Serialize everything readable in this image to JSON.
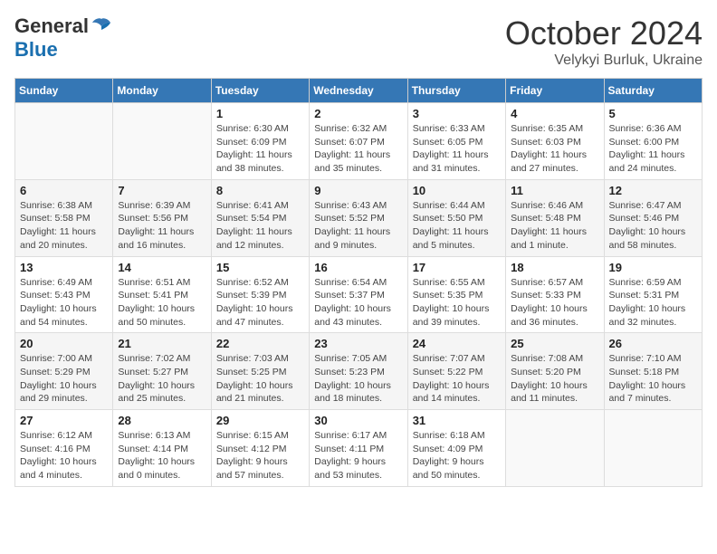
{
  "header": {
    "logo_general": "General",
    "logo_blue": "Blue",
    "month": "October 2024",
    "location": "Velykyi Burluk, Ukraine"
  },
  "weekdays": [
    "Sunday",
    "Monday",
    "Tuesday",
    "Wednesday",
    "Thursday",
    "Friday",
    "Saturday"
  ],
  "weeks": [
    [
      {
        "day": "",
        "sunrise": "",
        "sunset": "",
        "daylight": ""
      },
      {
        "day": "",
        "sunrise": "",
        "sunset": "",
        "daylight": ""
      },
      {
        "day": "1",
        "sunrise": "Sunrise: 6:30 AM",
        "sunset": "Sunset: 6:09 PM",
        "daylight": "Daylight: 11 hours and 38 minutes."
      },
      {
        "day": "2",
        "sunrise": "Sunrise: 6:32 AM",
        "sunset": "Sunset: 6:07 PM",
        "daylight": "Daylight: 11 hours and 35 minutes."
      },
      {
        "day": "3",
        "sunrise": "Sunrise: 6:33 AM",
        "sunset": "Sunset: 6:05 PM",
        "daylight": "Daylight: 11 hours and 31 minutes."
      },
      {
        "day": "4",
        "sunrise": "Sunrise: 6:35 AM",
        "sunset": "Sunset: 6:03 PM",
        "daylight": "Daylight: 11 hours and 27 minutes."
      },
      {
        "day": "5",
        "sunrise": "Sunrise: 6:36 AM",
        "sunset": "Sunset: 6:00 PM",
        "daylight": "Daylight: 11 hours and 24 minutes."
      }
    ],
    [
      {
        "day": "6",
        "sunrise": "Sunrise: 6:38 AM",
        "sunset": "Sunset: 5:58 PM",
        "daylight": "Daylight: 11 hours and 20 minutes."
      },
      {
        "day": "7",
        "sunrise": "Sunrise: 6:39 AM",
        "sunset": "Sunset: 5:56 PM",
        "daylight": "Daylight: 11 hours and 16 minutes."
      },
      {
        "day": "8",
        "sunrise": "Sunrise: 6:41 AM",
        "sunset": "Sunset: 5:54 PM",
        "daylight": "Daylight: 11 hours and 12 minutes."
      },
      {
        "day": "9",
        "sunrise": "Sunrise: 6:43 AM",
        "sunset": "Sunset: 5:52 PM",
        "daylight": "Daylight: 11 hours and 9 minutes."
      },
      {
        "day": "10",
        "sunrise": "Sunrise: 6:44 AM",
        "sunset": "Sunset: 5:50 PM",
        "daylight": "Daylight: 11 hours and 5 minutes."
      },
      {
        "day": "11",
        "sunrise": "Sunrise: 6:46 AM",
        "sunset": "Sunset: 5:48 PM",
        "daylight": "Daylight: 11 hours and 1 minute."
      },
      {
        "day": "12",
        "sunrise": "Sunrise: 6:47 AM",
        "sunset": "Sunset: 5:46 PM",
        "daylight": "Daylight: 10 hours and 58 minutes."
      }
    ],
    [
      {
        "day": "13",
        "sunrise": "Sunrise: 6:49 AM",
        "sunset": "Sunset: 5:43 PM",
        "daylight": "Daylight: 10 hours and 54 minutes."
      },
      {
        "day": "14",
        "sunrise": "Sunrise: 6:51 AM",
        "sunset": "Sunset: 5:41 PM",
        "daylight": "Daylight: 10 hours and 50 minutes."
      },
      {
        "day": "15",
        "sunrise": "Sunrise: 6:52 AM",
        "sunset": "Sunset: 5:39 PM",
        "daylight": "Daylight: 10 hours and 47 minutes."
      },
      {
        "day": "16",
        "sunrise": "Sunrise: 6:54 AM",
        "sunset": "Sunset: 5:37 PM",
        "daylight": "Daylight: 10 hours and 43 minutes."
      },
      {
        "day": "17",
        "sunrise": "Sunrise: 6:55 AM",
        "sunset": "Sunset: 5:35 PM",
        "daylight": "Daylight: 10 hours and 39 minutes."
      },
      {
        "day": "18",
        "sunrise": "Sunrise: 6:57 AM",
        "sunset": "Sunset: 5:33 PM",
        "daylight": "Daylight: 10 hours and 36 minutes."
      },
      {
        "day": "19",
        "sunrise": "Sunrise: 6:59 AM",
        "sunset": "Sunset: 5:31 PM",
        "daylight": "Daylight: 10 hours and 32 minutes."
      }
    ],
    [
      {
        "day": "20",
        "sunrise": "Sunrise: 7:00 AM",
        "sunset": "Sunset: 5:29 PM",
        "daylight": "Daylight: 10 hours and 29 minutes."
      },
      {
        "day": "21",
        "sunrise": "Sunrise: 7:02 AM",
        "sunset": "Sunset: 5:27 PM",
        "daylight": "Daylight: 10 hours and 25 minutes."
      },
      {
        "day": "22",
        "sunrise": "Sunrise: 7:03 AM",
        "sunset": "Sunset: 5:25 PM",
        "daylight": "Daylight: 10 hours and 21 minutes."
      },
      {
        "day": "23",
        "sunrise": "Sunrise: 7:05 AM",
        "sunset": "Sunset: 5:23 PM",
        "daylight": "Daylight: 10 hours and 18 minutes."
      },
      {
        "day": "24",
        "sunrise": "Sunrise: 7:07 AM",
        "sunset": "Sunset: 5:22 PM",
        "daylight": "Daylight: 10 hours and 14 minutes."
      },
      {
        "day": "25",
        "sunrise": "Sunrise: 7:08 AM",
        "sunset": "Sunset: 5:20 PM",
        "daylight": "Daylight: 10 hours and 11 minutes."
      },
      {
        "day": "26",
        "sunrise": "Sunrise: 7:10 AM",
        "sunset": "Sunset: 5:18 PM",
        "daylight": "Daylight: 10 hours and 7 minutes."
      }
    ],
    [
      {
        "day": "27",
        "sunrise": "Sunrise: 6:12 AM",
        "sunset": "Sunset: 4:16 PM",
        "daylight": "Daylight: 10 hours and 4 minutes."
      },
      {
        "day": "28",
        "sunrise": "Sunrise: 6:13 AM",
        "sunset": "Sunset: 4:14 PM",
        "daylight": "Daylight: 10 hours and 0 minutes."
      },
      {
        "day": "29",
        "sunrise": "Sunrise: 6:15 AM",
        "sunset": "Sunset: 4:12 PM",
        "daylight": "Daylight: 9 hours and 57 minutes."
      },
      {
        "day": "30",
        "sunrise": "Sunrise: 6:17 AM",
        "sunset": "Sunset: 4:11 PM",
        "daylight": "Daylight: 9 hours and 53 minutes."
      },
      {
        "day": "31",
        "sunrise": "Sunrise: 6:18 AM",
        "sunset": "Sunset: 4:09 PM",
        "daylight": "Daylight: 9 hours and 50 minutes."
      },
      {
        "day": "",
        "sunrise": "",
        "sunset": "",
        "daylight": ""
      },
      {
        "day": "",
        "sunrise": "",
        "sunset": "",
        "daylight": ""
      }
    ]
  ]
}
